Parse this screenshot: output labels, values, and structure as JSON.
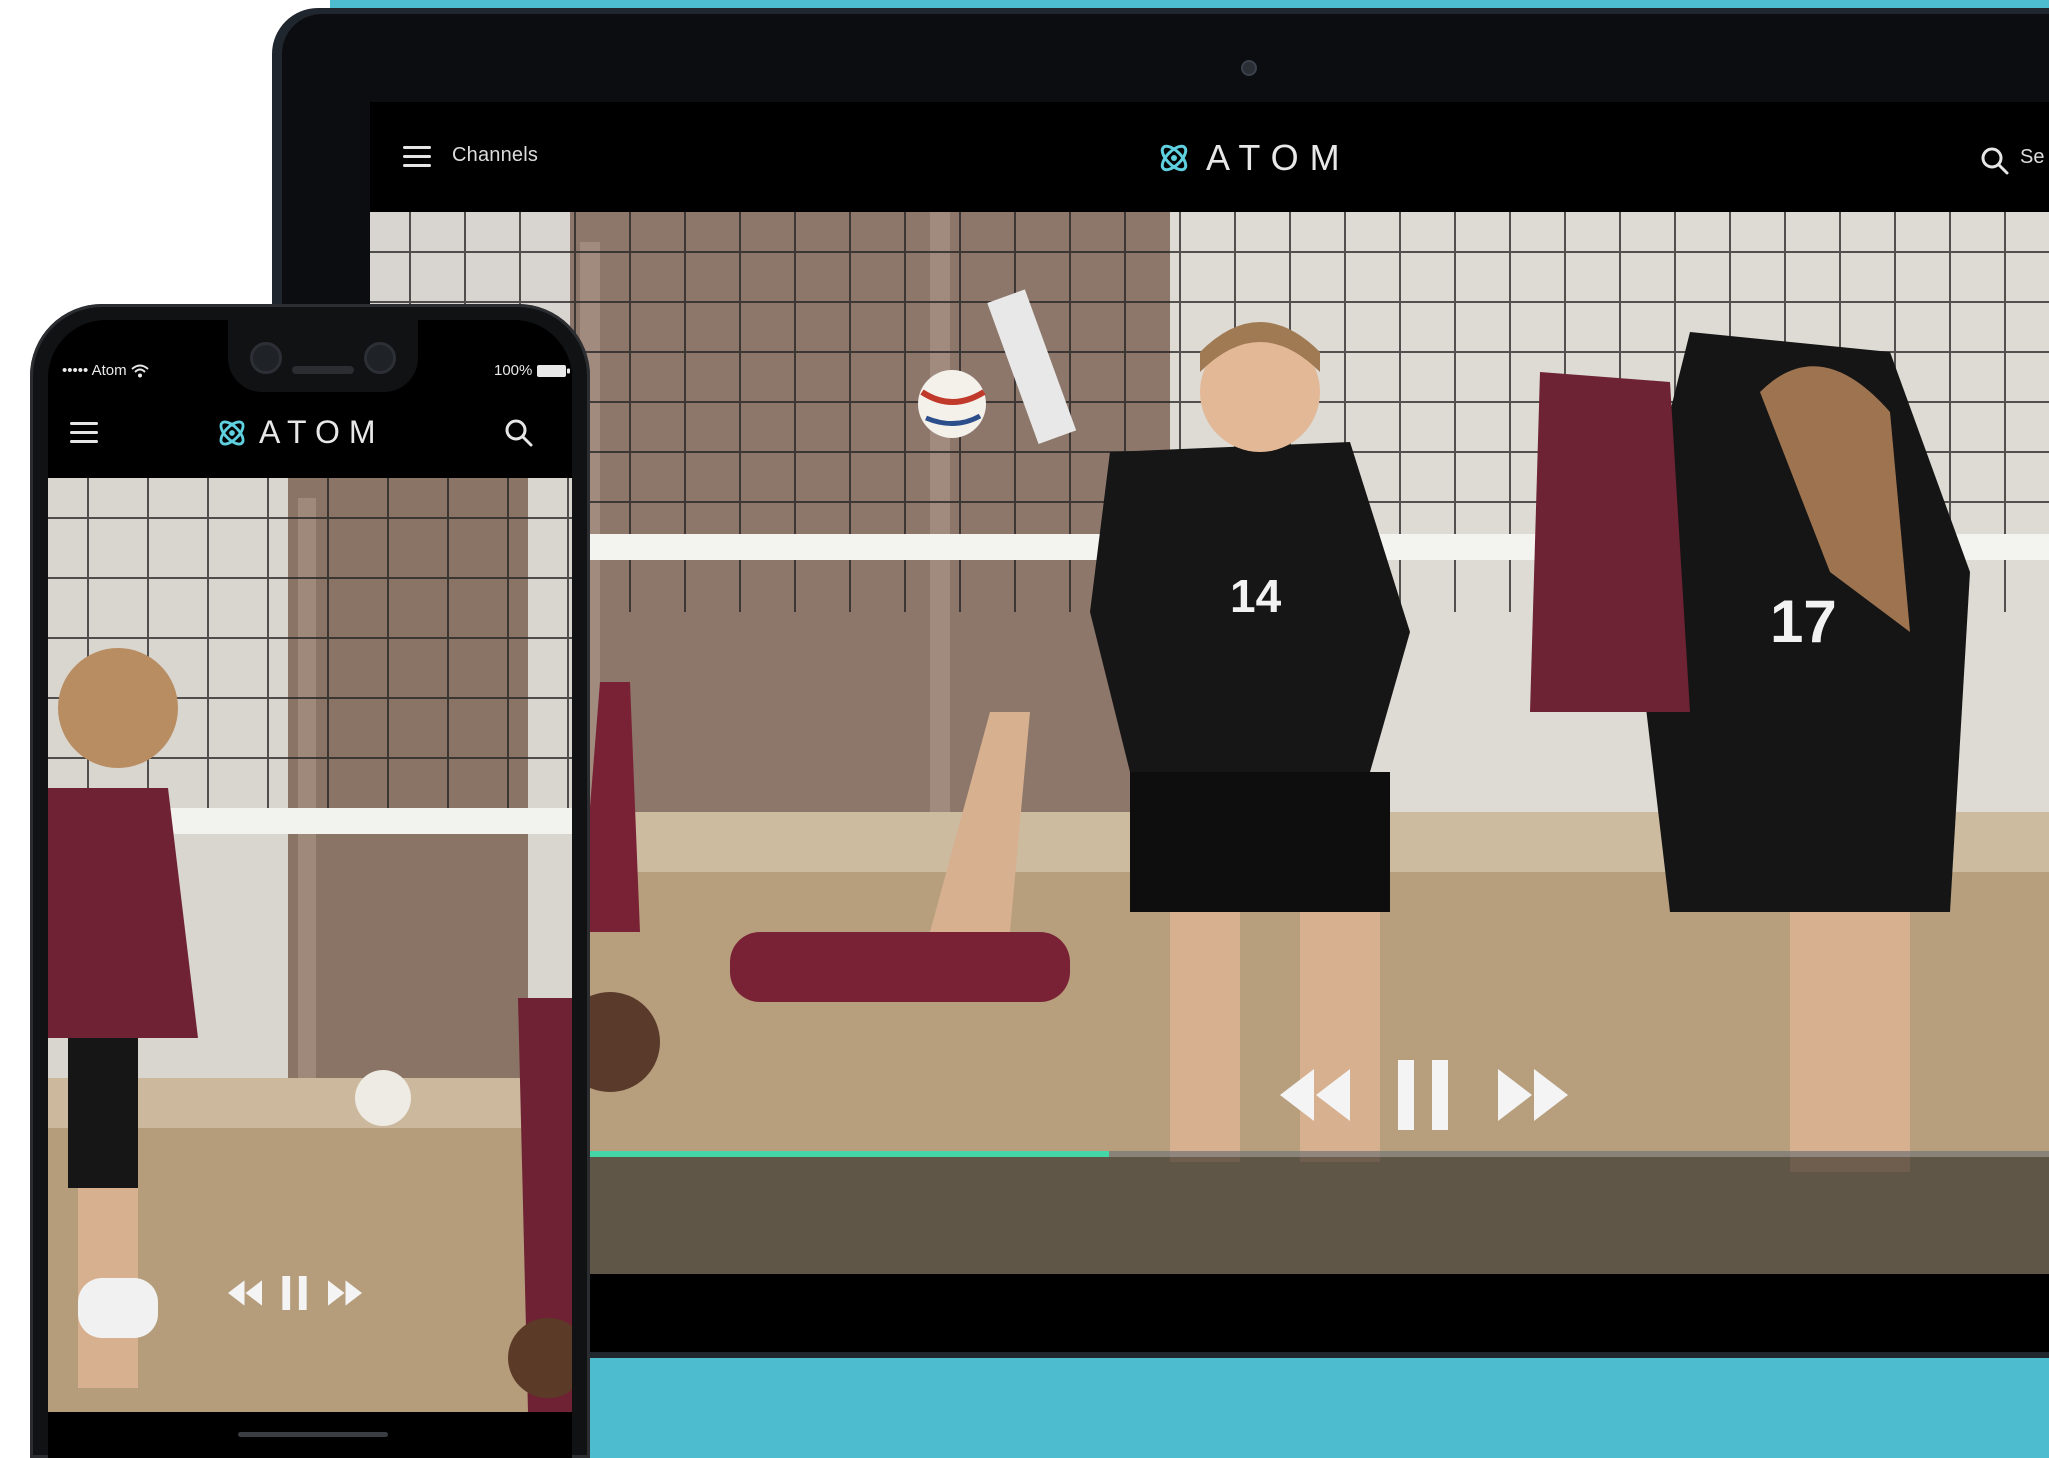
{
  "tablet": {
    "header": {
      "menu_label": "Channels",
      "brand": "ATOM",
      "search_label": "Se"
    },
    "player": {
      "progress": 0.434,
      "accent_color": "#44d6a6"
    }
  },
  "phone": {
    "status": {
      "carrier": "••••• Atom",
      "battery": "100%"
    },
    "header": {
      "brand": "ATOM"
    }
  },
  "colors": {
    "backdrop": "#4dbccf",
    "header_bg": "#000000",
    "progress": "#44d6a6"
  },
  "icons": [
    "menu-icon",
    "atom-logo-icon",
    "search-icon",
    "rewind-icon",
    "pause-icon",
    "fast-forward-icon",
    "wifi-icon",
    "battery-icon"
  ]
}
